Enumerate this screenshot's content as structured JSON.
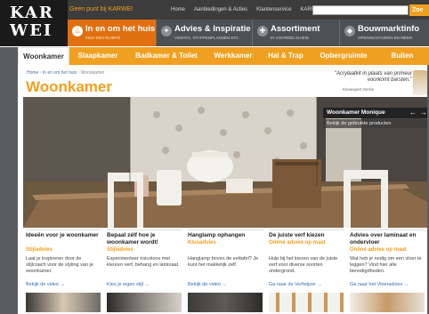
{
  "logo": {
    "line1": "KAR",
    "line2": "WEI"
  },
  "topbar": {
    "tagline": "Geen punt bij KARWEI",
    "links": [
      "Home",
      "Aanbiedingen & Acties",
      "Klantenservice",
      "KARWEI KAART"
    ],
    "search_button": "Zoe"
  },
  "categories": [
    {
      "title": "In en om het huis",
      "sub": "KIES EEN RUIMTE",
      "icon": "house-icon"
    },
    {
      "title": "Advies & Inspiratie",
      "sub": "VIDEO'S, STAPPENPLANNEN ETC.",
      "icon": "lightbulb-icon"
    },
    {
      "title": "Assortiment",
      "sub": "IN VOORDELIGHEID",
      "icon": "tools-icon"
    },
    {
      "title": "Bouwmarktinfo",
      "sub": "OPENINGSTIJDEN EN MEER",
      "icon": "store-icon"
    }
  ],
  "subnav": [
    "Woonkamer",
    "Slaapkamer",
    "Badkamer & Toilet",
    "Werkkamer",
    "Hal & Trap",
    "Opbergruimte",
    "Buiten"
  ],
  "breadcrumb": [
    "Home",
    "In en om het huis",
    "Woonkamer"
  ],
  "page_title": "Woonkamer",
  "quote": {
    "text": "\"Acrylaatkit in plaats van primeur voorkomt barsten.\"",
    "author": "Klusexpert Gerrie"
  },
  "hero_overlay": {
    "title": "Woonkamer Monique",
    "sub": "Bekijk de gebruikte producten"
  },
  "cards": [
    {
      "title": "Ideeën voor je woonkamer",
      "sub": "Stijladvies",
      "body": "Laat je inspireren door de stijlcoach voor de styling van je woonkamer.",
      "link": "Bekijk de video"
    },
    {
      "title": "Bepaal zélf hoe je woonkamer wordt!",
      "sub": "Stijladvies",
      "body": "Experimenteer risicoloos met kleuren verf, behang en laminaat.",
      "link": "Kies je eigen stijl"
    },
    {
      "title": "Hanglamp ophangen",
      "sub": "Klusadvies",
      "body": "Hanglamp boven de eettafel? Je kunt het makkelijk zelf.",
      "link": "Bekijk de video"
    },
    {
      "title": "De juiste verf kiezen",
      "sub": "Online advies op maat",
      "body": "Hulp bij het kiezen van de juiste verf voor diverse soorten ondergrond.",
      "link": "Ga naar de Verfwijzer"
    },
    {
      "title": "Advies over laminaat en ondervloer",
      "sub": "Online advies op maat",
      "body": "Wat heb je nodig om een vloer te leggen? Vind hier alle benodigdheden.",
      "link": "Ga naar het Vloeradvies"
    }
  ],
  "colors": {
    "orange": "#f0a020",
    "active_tab": "#e0700f",
    "dark": "#3c3c3c",
    "link": "#3a6cb3"
  }
}
